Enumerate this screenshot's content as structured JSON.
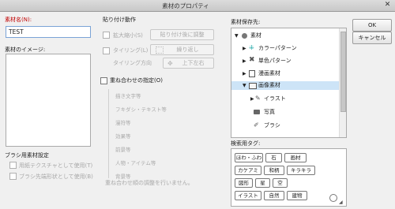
{
  "window": {
    "title": "素材のプロパティ",
    "close_glyph": "✕"
  },
  "name_section": {
    "label": "素材名(N):",
    "value": "TEST"
  },
  "image_section": {
    "label": "素材のイメージ:"
  },
  "brush": {
    "heading": "ブラシ用素材設定",
    "opt1": "用紙テクスチャとして使用(T)",
    "opt2": "ブラシ先端形状として使用(B)"
  },
  "paste": {
    "heading": "貼り付け動作",
    "scale_label": "拡大縮小(S)",
    "scale_value": "貼り付け後に調整",
    "tiling_label": "タイリング(L)",
    "tiling_value": "繰り返し",
    "direction_label": "タイリング方向",
    "direction_value": "上下左右"
  },
  "layering": {
    "label": "重ね合わせの指定(O)",
    "items": [
      "描き文字等",
      "フキダシ・テキスト等",
      "漫符等",
      "効果等",
      "前景等",
      "人物・アイテム等",
      "背景等"
    ],
    "note": "重ね合わせ順の調整を行いません。"
  },
  "save_dest": {
    "label": "素材保存先:",
    "tree": [
      {
        "label": "素材",
        "level": 0,
        "arrow": "▼",
        "icon": "globe-icon"
      },
      {
        "label": "カラーパターン",
        "level": 1,
        "arrow": "▶",
        "icon": "color-pattern-icon"
      },
      {
        "label": "単色パターン",
        "level": 1,
        "arrow": "▶",
        "icon": "mono-pattern-icon"
      },
      {
        "label": "漫画素材",
        "level": 1,
        "arrow": "▶",
        "icon": "manga-icon"
      },
      {
        "label": "画像素材",
        "level": 1,
        "arrow": "▼",
        "icon": "image-icon",
        "selected": true
      },
      {
        "label": "イラスト",
        "level": 2,
        "arrow": "▶",
        "icon": "illust-icon"
      },
      {
        "label": "写真",
        "level": 2,
        "arrow": "",
        "icon": "photo-icon"
      },
      {
        "label": "ブラシ",
        "level": 2,
        "arrow": "",
        "icon": "brush-icon"
      }
    ]
  },
  "search_tags": {
    "label": "検索用タグ:",
    "tags": [
      "ほわ・ふわ",
      "石",
      "画材",
      "カケアミ",
      "和柄",
      "キラキラ",
      "図形",
      "星",
      "空",
      "イラスト",
      "自然",
      "建物"
    ]
  },
  "buttons": {
    "ok": "OK",
    "cancel": "キャンセル"
  },
  "colors": {
    "selection": "#cde4f7",
    "required": "#c00000",
    "focus": "#7aa3d6"
  }
}
